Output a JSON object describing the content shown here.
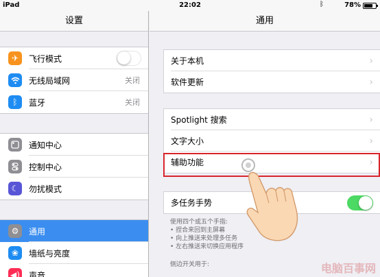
{
  "statusbar": {
    "carrier": "iPad",
    "time": "22:02",
    "battery_text": "78%",
    "battery_level": 0.78,
    "bluetooth_icon": "bluetooth-icon"
  },
  "left": {
    "title": "设置",
    "groups": [
      [
        {
          "label": "飞行模式",
          "icon": "airplane-icon",
          "color": "#f7931e",
          "toggle": false
        },
        {
          "label": "无线局域网",
          "icon": "wifi-icon",
          "color": "#1e8cf2",
          "value": "关闭"
        },
        {
          "label": "蓝牙",
          "icon": "bluetooth-icon",
          "color": "#1e8cf2",
          "value": "关闭"
        }
      ],
      [
        {
          "label": "通知中心",
          "icon": "notification-center-icon",
          "color": "#8e8e93"
        },
        {
          "label": "控制中心",
          "icon": "control-center-icon",
          "color": "#8e8e93"
        },
        {
          "label": "勿扰模式",
          "icon": "moon-icon",
          "color": "#5856d6"
        }
      ],
      [
        {
          "label": "通用",
          "icon": "gear-icon",
          "color": "#8e8e93",
          "selected": true
        },
        {
          "label": "墙纸与亮度",
          "icon": "wallpaper-icon",
          "color": "#1e8cf2"
        },
        {
          "label": "声音",
          "icon": "sound-icon",
          "color": "#ff2d55"
        }
      ]
    ]
  },
  "right": {
    "title": "通用",
    "group1": [
      "关于本机",
      "软件更新"
    ],
    "group2": [
      "Spotlight 搜索",
      "文字大小",
      "辅助功能"
    ],
    "group3": {
      "label": "多任务手势",
      "toggle": true
    },
    "footer_lines": [
      "使用四个或五个手指:",
      "• 捏合来回到主屏幕",
      "• 向上推送来处理多任务",
      "• 左右推送来切换应用程序"
    ],
    "side_switch_header": "侧边开关用于:"
  },
  "watermark": "电脑百事网"
}
